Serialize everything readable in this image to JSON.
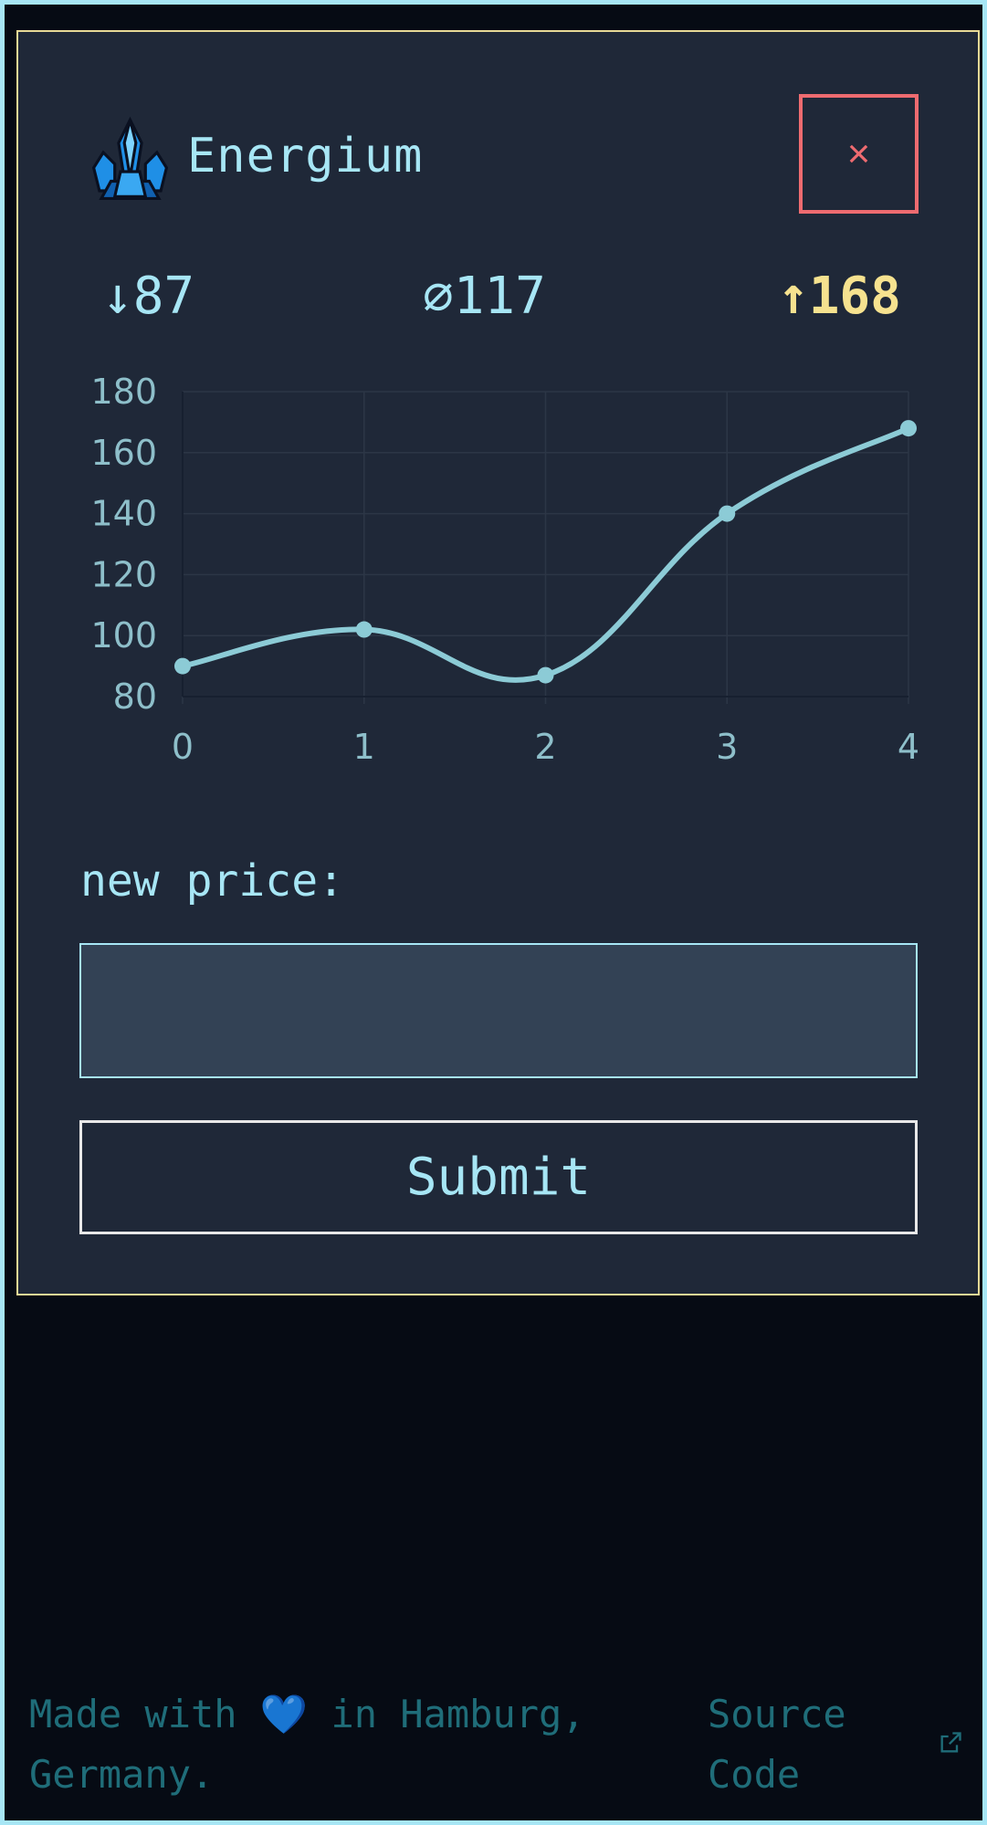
{
  "header": {
    "title": "Energium",
    "icon": "crystal-icon",
    "close_label": "×"
  },
  "stats": {
    "min": "↓87",
    "avg": "⌀117",
    "max": "↑168",
    "max_color": "#f6e28f"
  },
  "chart_data": {
    "type": "line",
    "x": [
      0,
      1,
      2,
      3,
      4
    ],
    "values": [
      90,
      102,
      87,
      140,
      168
    ],
    "xlabel": "",
    "ylabel": "",
    "ylim": [
      80,
      180
    ],
    "y_ticks": [
      80,
      100,
      120,
      140,
      160,
      180
    ],
    "x_ticks": [
      0,
      1,
      2,
      3,
      4
    ],
    "grid": true,
    "line_color": "#8ccbd6"
  },
  "form": {
    "label": "new price:",
    "input_value": "",
    "input_placeholder": "",
    "submit_label": "Submit"
  },
  "footer": {
    "text_before": "Made with ",
    "heart": "💙",
    "text_after": " in Hamburg, Germany.",
    "source_link": "Source Code",
    "external_icon": "external-link-icon"
  },
  "colors": {
    "page_border": "#a7e6f5",
    "card_border": "#e7d996",
    "close_border": "#ee6b70",
    "accent": "#a7e6f5"
  }
}
